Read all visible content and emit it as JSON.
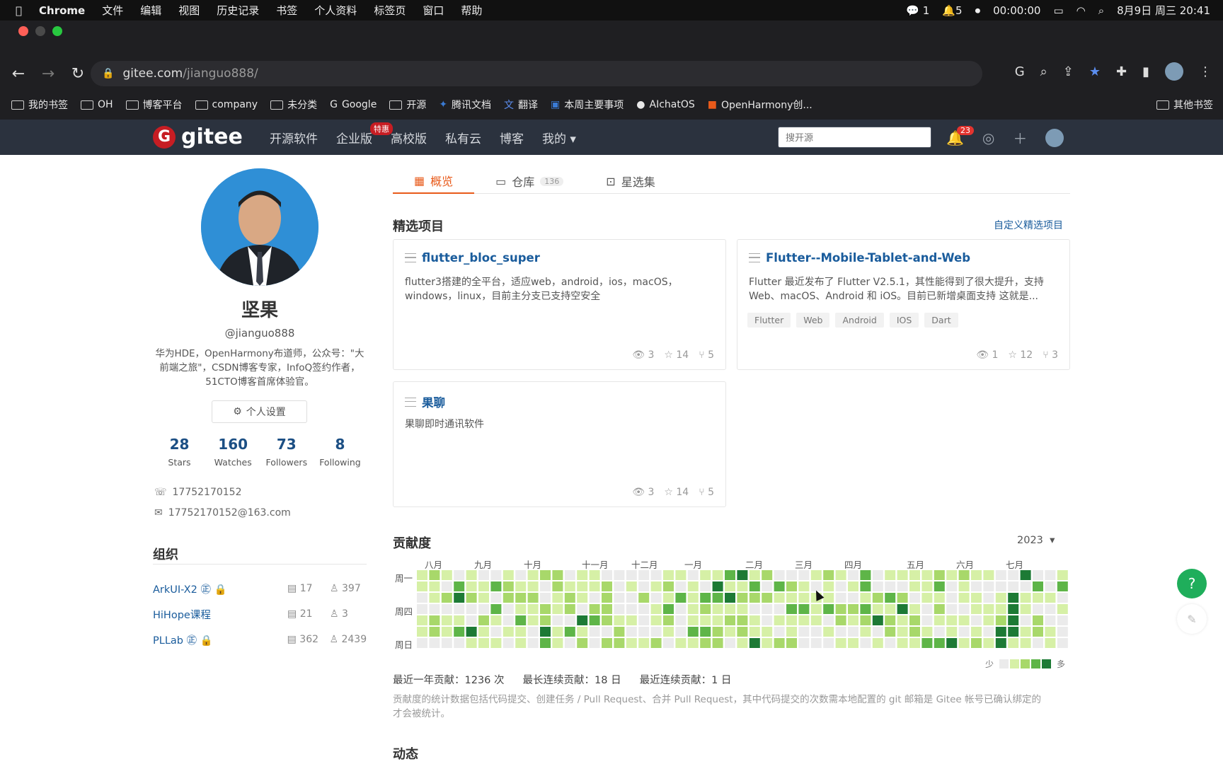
{
  "menubar": {
    "app": "Chrome",
    "items": [
      "文件",
      "编辑",
      "视图",
      "历史记录",
      "书签",
      "个人资料",
      "标签页",
      "窗口",
      "帮助"
    ],
    "wechat_count": "1",
    "notif_count": "5",
    "timer": "00:00:00",
    "datetime": "8月9日 周三 20:41"
  },
  "browser": {
    "url_domain": "gitee.com",
    "url_path": "/jianguo888/"
  },
  "bookmarks": {
    "items": [
      "我的书签",
      "OH",
      "博客平台",
      "company",
      "未分类",
      "Google",
      "开源",
      "腾讯文档",
      "翻译",
      "本周主要事项",
      "AIchatOS",
      "OpenHarmony创..."
    ],
    "other": "其他书签"
  },
  "gitee_nav": {
    "logo": "gitee",
    "links": [
      "开源软件",
      "企业版",
      "高校版",
      "私有云",
      "博客",
      "我的"
    ],
    "enterprise_badge": "特惠",
    "search_placeholder": "搜开源",
    "notif_count": "23"
  },
  "profile": {
    "name": "坚果",
    "handle": "@jianguo888",
    "bio": "华为HDE，OpenHarmony布道师，公众号：\"大前端之旅\"，CSDN博客专家，InfoQ签约作者，51CTO博客首席体验官。",
    "settings_label": "个人设置",
    "stats": [
      {
        "n": "28",
        "l": "Stars"
      },
      {
        "n": "160",
        "l": "Watches"
      },
      {
        "n": "73",
        "l": "Followers"
      },
      {
        "n": "8",
        "l": "Following"
      }
    ],
    "phone": "17752170152",
    "email": "17752170152@163.com"
  },
  "orgs": {
    "title": "组织",
    "items": [
      {
        "name": "ArkUI-X2",
        "repos": "17",
        "members": "397"
      },
      {
        "name": "HiHope课程",
        "repos": "21",
        "members": "3"
      },
      {
        "name": "PLLab",
        "repos": "362",
        "members": "2439"
      }
    ]
  },
  "tabs": [
    {
      "label": "概览"
    },
    {
      "label": "仓库",
      "count": "136"
    },
    {
      "label": "星选集"
    }
  ],
  "featured": {
    "title": "精选项目",
    "custom_link": "自定义精选项目",
    "cards": [
      {
        "title": "flutter_bloc_super",
        "desc": "flutter3搭建的全平台，适应web，android，ios，macOS，windows，linux，目前主分支已支持空安全",
        "tags": [],
        "watch": "3",
        "star": "14",
        "fork": "5"
      },
      {
        "title": "Flutter--Mobile-Tablet-and-Web",
        "desc": "Flutter 最近发布了 Flutter V2.5.1，其性能得到了很大提升，支持 Web、macOS、Android 和 iOS。目前已新增桌面支持 这就是...",
        "tags": [
          "Flutter",
          "Web",
          "Android",
          "IOS",
          "Dart"
        ],
        "watch": "1",
        "star": "12",
        "fork": "3"
      },
      {
        "title": "果聊",
        "desc": "果聊即时通讯软件",
        "tags": [],
        "watch": "3",
        "star": "14",
        "fork": "5"
      }
    ]
  },
  "contrib": {
    "title": "贡献度",
    "year": "2023",
    "months": [
      "八月",
      "九月",
      "十月",
      "十一月",
      "十二月",
      "一月",
      "二月",
      "三月",
      "四月",
      "五月",
      "六月",
      "七月"
    ],
    "days": [
      "周一",
      "周四",
      "周日"
    ],
    "legend_less": "少",
    "legend_more": "多",
    "summary": [
      "最近一年贡献：1236 次",
      "最长连续贡献：18 日",
      "最近连续贡献：1 日"
    ],
    "note": "贡献度的统计数据包括代码提交、创建任务 / Pull Request、合并 Pull Request，其中代码提交的次数需本地配置的 git 邮箱是 Gitee 帐号已确认绑定的才会被统计。",
    "colors": [
      "#ebebeb",
      "#d6f0a6",
      "#a8d86a",
      "#5eb548",
      "#1d7a35"
    ]
  },
  "activity": {
    "title": "动态"
  }
}
